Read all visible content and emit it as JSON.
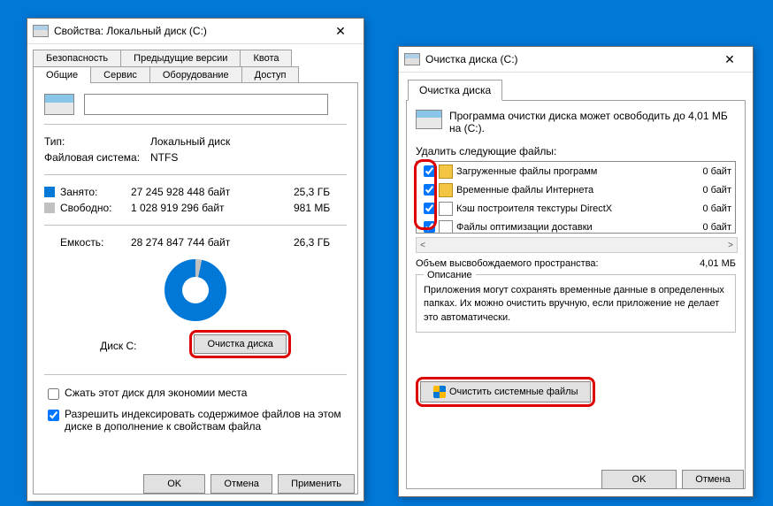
{
  "properties": {
    "title": "Свойства: Локальный диск (C:)",
    "tabs_row1": [
      "Безопасность",
      "Предыдущие версии",
      "Квота"
    ],
    "tabs_row2": [
      "Общие",
      "Сервис",
      "Оборудование",
      "Доступ"
    ],
    "active_tab": "Общие",
    "type_label": "Тип:",
    "type_value": "Локальный диск",
    "fs_label": "Файловая система:",
    "fs_value": "NTFS",
    "used_label": "Занято:",
    "used_bytes": "27 245 928 448 байт",
    "used_gb": "25,3 ГБ",
    "free_label": "Свободно:",
    "free_bytes": "1 028 919 296 байт",
    "free_gb": "981 МБ",
    "capacity_label": "Емкость:",
    "capacity_bytes": "28 274 847 744 байт",
    "capacity_gb": "26,3 ГБ",
    "disk_label": "Диск C:",
    "cleanup_btn": "Очистка диска",
    "compress_label": "Сжать этот диск для экономии места",
    "index_label": "Разрешить индексировать содержимое файлов на этом диске в дополнение к свойствам файла",
    "ok": "OK",
    "cancel": "Отмена",
    "apply": "Применить"
  },
  "cleanup": {
    "title": "Очистка диска  (C:)",
    "tab": "Очистка диска",
    "intro": "Программа очистки диска может освободить до 4,01 МБ на  (C:).",
    "delete_label": "Удалить следующие файлы:",
    "files": [
      {
        "name": "Загруженные файлы программ",
        "size": "0 байт",
        "icon": "folder"
      },
      {
        "name": "Временные файлы Интернета",
        "size": "0 байт",
        "icon": "folder"
      },
      {
        "name": "Кэш построителя текстуры DirectX",
        "size": "0 байт",
        "icon": "page"
      },
      {
        "name": "Файлы оптимизации доставки",
        "size": "0 байт",
        "icon": "page"
      }
    ],
    "total_label": "Объем высвобождаемого пространства:",
    "total_value": "4,01 МБ",
    "desc_title": "Описание",
    "desc_text": "Приложения могут сохранять временные данные в определенных папках. Их можно очистить вручную, если приложение не делает это автоматически.",
    "sys_clean_btn": "Очистить системные файлы",
    "ok": "OK",
    "cancel": "Отмена"
  }
}
